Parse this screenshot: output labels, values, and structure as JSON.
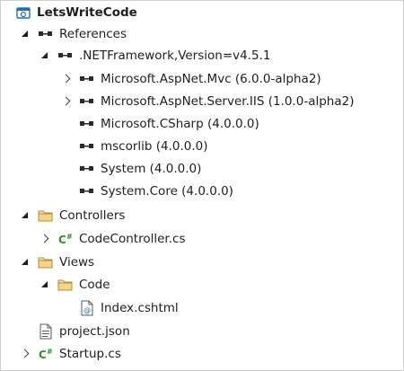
{
  "solution_explorer": {
    "project": {
      "label": "LetsWriteCode",
      "icon": "web-project-icon"
    },
    "references": {
      "label": "References",
      "icon": "references-icon"
    },
    "framework": {
      "label": ".NETFramework,Version=v4.5.1",
      "icon": "references-icon"
    },
    "ref_items": [
      {
        "label": "Microsoft.AspNet.Mvc (6.0.0-alpha2)",
        "icon": "reference-icon",
        "state": "collapsed"
      },
      {
        "label": "Microsoft.AspNet.Server.IIS (1.0.0-alpha2)",
        "icon": "reference-icon",
        "state": "collapsed"
      },
      {
        "label": "Microsoft.CSharp (4.0.0.0)",
        "icon": "reference-icon",
        "state": "none"
      },
      {
        "label": "mscorlib (4.0.0.0)",
        "icon": "reference-icon",
        "state": "none"
      },
      {
        "label": "System (4.0.0.0)",
        "icon": "reference-icon",
        "state": "none"
      },
      {
        "label": "System.Core (4.0.0.0)",
        "icon": "reference-icon",
        "state": "none"
      }
    ],
    "controllers": {
      "label": "Controllers",
      "icon": "folder-icon"
    },
    "code_controller": {
      "label": "CodeController.cs",
      "icon": "csharp-file-icon"
    },
    "views": {
      "label": "Views",
      "icon": "folder-icon"
    },
    "code_folder": {
      "label": "Code",
      "icon": "folder-icon"
    },
    "index_view": {
      "label": "Index.cshtml",
      "icon": "razor-file-icon"
    },
    "project_json": {
      "label": "project.json",
      "icon": "json-file-icon"
    },
    "startup": {
      "label": "Startup.cs",
      "icon": "csharp-file-icon"
    }
  },
  "colors": {
    "folder": "#dcb67a",
    "csharp": "#388a34",
    "project": "#1f6fb2",
    "text": "#1e1e1e"
  }
}
